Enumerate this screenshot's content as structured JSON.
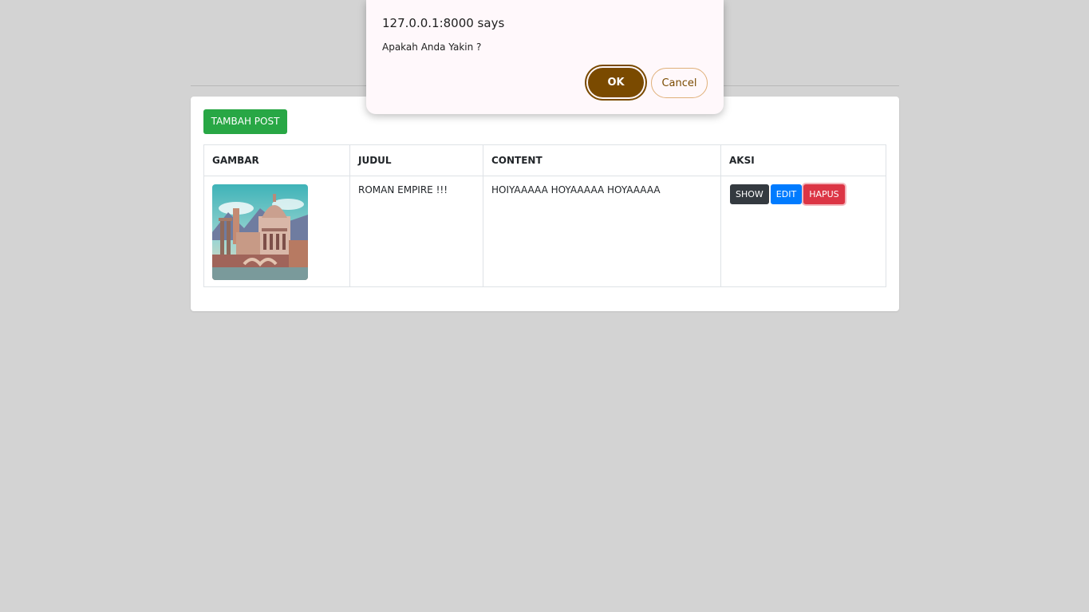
{
  "dialog": {
    "title": "127.0.0.1:8000 says",
    "message": "Apakah Anda Yakin ?",
    "ok_label": "OK",
    "cancel_label": "Cancel"
  },
  "toolbar": {
    "add_label": "TAMBAH POST"
  },
  "table": {
    "headers": [
      "GAMBAR",
      "JUDUL",
      "CONTENT",
      "AKSI"
    ],
    "rows": [
      {
        "image_icon": "roman-city-illustration",
        "title": "ROMAN EMPIRE !!!",
        "content": "HOIYAAAAA HOYAAAAA HOYAAAAA",
        "actions": {
          "show": "SHOW",
          "edit": "EDIT",
          "delete": "HAPUS"
        }
      }
    ]
  },
  "colors": {
    "page_background": "#d3d3d3",
    "add_button": "#28a745",
    "show_button": "#343a40",
    "edit_button": "#007bff",
    "delete_button": "#dc3545",
    "dialog_ok": "#7a4a00"
  }
}
